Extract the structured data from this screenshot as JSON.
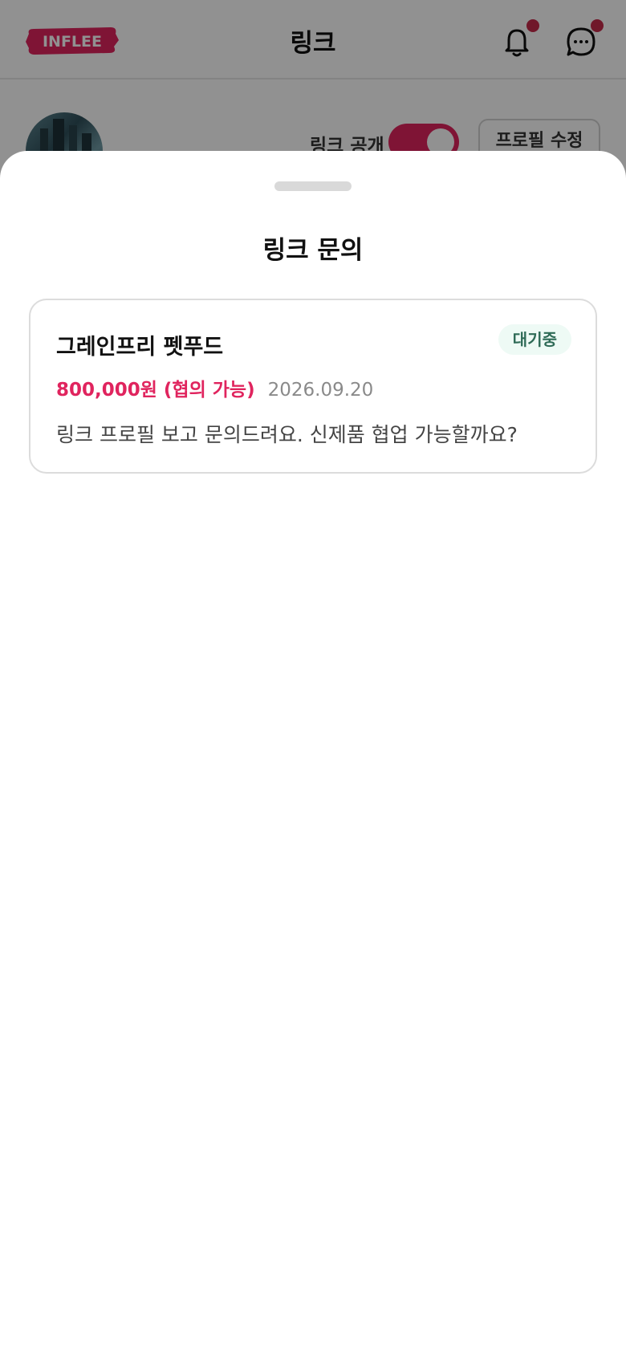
{
  "header": {
    "logo_text": "INFLEE",
    "title": "링크",
    "notification_badge_color": "#c62b4b",
    "accent_color": "#e0245e"
  },
  "profile": {
    "toggle_label": "링크 공개",
    "toggle_on": true,
    "edit_button": "프로필 수정"
  },
  "sheet": {
    "title": "링크 문의",
    "inquiries": [
      {
        "company": "그레인프리 펫푸드",
        "status": "대기중",
        "price": "800,000원 (협의 가능)",
        "date": "2026.09.20",
        "message": "링크 프로필 보고 문의드려요. 신제품 협업 가능할까요?"
      }
    ]
  }
}
